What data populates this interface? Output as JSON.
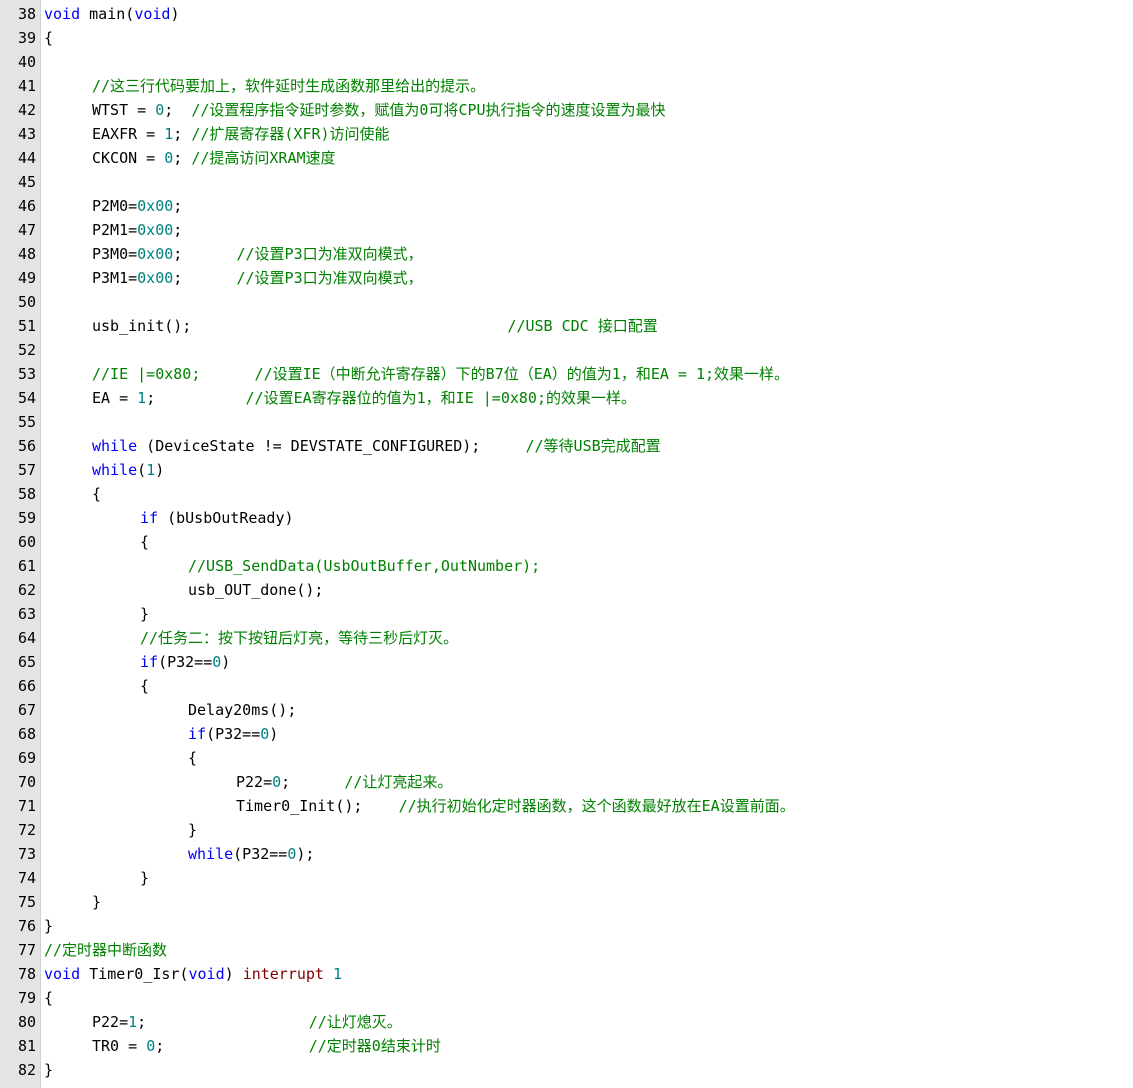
{
  "colors": {
    "keyword": "#0000ff",
    "number": "#008080",
    "comment": "#008000",
    "special": "#800000",
    "text": "#000000",
    "gutter": "#e4e4e4"
  },
  "lines": [
    {
      "n": "38",
      "indent": 0,
      "tokens": [
        {
          "t": "void",
          "c": "kw"
        },
        {
          "t": " main(",
          "c": "tx"
        },
        {
          "t": "void",
          "c": "kw"
        },
        {
          "t": ")",
          "c": "tx"
        }
      ]
    },
    {
      "n": "39",
      "indent": 0,
      "tokens": [
        {
          "t": "{",
          "c": "tx"
        }
      ]
    },
    {
      "n": "40",
      "indent": 0,
      "tokens": []
    },
    {
      "n": "41",
      "indent": 1,
      "tokens": [
        {
          "t": "//这三行代码要加上，软件延时生成函数那里给出的提示。",
          "c": "cm"
        }
      ]
    },
    {
      "n": "42",
      "indent": 1,
      "tokens": [
        {
          "t": "WTST = ",
          "c": "tx"
        },
        {
          "t": "0",
          "c": "num"
        },
        {
          "t": ";  ",
          "c": "tx"
        },
        {
          "t": "//设置程序指令延时参数，赋值为0可将CPU执行指令的速度设置为最快",
          "c": "cm"
        }
      ]
    },
    {
      "n": "43",
      "indent": 1,
      "tokens": [
        {
          "t": "EAXFR = ",
          "c": "tx"
        },
        {
          "t": "1",
          "c": "num"
        },
        {
          "t": "; ",
          "c": "tx"
        },
        {
          "t": "//扩展寄存器(XFR)访问使能",
          "c": "cm"
        }
      ]
    },
    {
      "n": "44",
      "indent": 1,
      "tokens": [
        {
          "t": "CKCON = ",
          "c": "tx"
        },
        {
          "t": "0",
          "c": "num"
        },
        {
          "t": "; ",
          "c": "tx"
        },
        {
          "t": "//提高访问XRAM速度",
          "c": "cm"
        }
      ]
    },
    {
      "n": "45",
      "indent": 0,
      "tokens": []
    },
    {
      "n": "46",
      "indent": 1,
      "tokens": [
        {
          "t": "P2M0=",
          "c": "tx"
        },
        {
          "t": "0x00",
          "c": "num"
        },
        {
          "t": ";",
          "c": "tx"
        }
      ]
    },
    {
      "n": "47",
      "indent": 1,
      "tokens": [
        {
          "t": "P2M1=",
          "c": "tx"
        },
        {
          "t": "0x00",
          "c": "num"
        },
        {
          "t": ";",
          "c": "tx"
        }
      ]
    },
    {
      "n": "48",
      "indent": 1,
      "tokens": [
        {
          "t": "P3M0=",
          "c": "tx"
        },
        {
          "t": "0x00",
          "c": "num"
        },
        {
          "t": ";      ",
          "c": "tx"
        },
        {
          "t": "//设置P3口为准双向模式，",
          "c": "cm"
        }
      ]
    },
    {
      "n": "49",
      "indent": 1,
      "tokens": [
        {
          "t": "P3M1=",
          "c": "tx"
        },
        {
          "t": "0x00",
          "c": "num"
        },
        {
          "t": ";      ",
          "c": "tx"
        },
        {
          "t": "//设置P3口为准双向模式，",
          "c": "cm"
        }
      ]
    },
    {
      "n": "50",
      "indent": 0,
      "tokens": []
    },
    {
      "n": "51",
      "indent": 1,
      "tokens": [
        {
          "t": "usb_init();                                   ",
          "c": "tx"
        },
        {
          "t": "//USB CDC 接口配置",
          "c": "cm"
        }
      ]
    },
    {
      "n": "52",
      "indent": 0,
      "tokens": []
    },
    {
      "n": "53",
      "indent": 1,
      "tokens": [
        {
          "t": "//IE |=0x80;      //设置IE（中断允许寄存器）下的B7位（EA）的值为1，和EA = 1;效果一样。",
          "c": "cm"
        }
      ]
    },
    {
      "n": "54",
      "indent": 1,
      "tokens": [
        {
          "t": "EA = ",
          "c": "tx"
        },
        {
          "t": "1",
          "c": "num"
        },
        {
          "t": ";          ",
          "c": "tx"
        },
        {
          "t": "//设置EA寄存器位的值为1，和IE |=0x80;的效果一样。",
          "c": "cm"
        }
      ]
    },
    {
      "n": "55",
      "indent": 0,
      "tokens": []
    },
    {
      "n": "56",
      "indent": 1,
      "tokens": [
        {
          "t": "while",
          "c": "kw"
        },
        {
          "t": " (DeviceState != DEVSTATE_CONFIGURED);     ",
          "c": "tx"
        },
        {
          "t": "//等待USB完成配置",
          "c": "cm"
        }
      ]
    },
    {
      "n": "57",
      "indent": 1,
      "tokens": [
        {
          "t": "while",
          "c": "kw"
        },
        {
          "t": "(",
          "c": "tx"
        },
        {
          "t": "1",
          "c": "num"
        },
        {
          "t": ")",
          "c": "tx"
        }
      ]
    },
    {
      "n": "58",
      "indent": 1,
      "tokens": [
        {
          "t": "{",
          "c": "tx"
        }
      ]
    },
    {
      "n": "59",
      "indent": 2,
      "tokens": [
        {
          "t": "if",
          "c": "kw"
        },
        {
          "t": " (bUsbOutReady)",
          "c": "tx"
        }
      ]
    },
    {
      "n": "60",
      "indent": 2,
      "tokens": [
        {
          "t": "{",
          "c": "tx"
        }
      ]
    },
    {
      "n": "61",
      "indent": 3,
      "tokens": [
        {
          "t": "//USB_SendData(UsbOutBuffer,OutNumber);",
          "c": "cm"
        }
      ]
    },
    {
      "n": "62",
      "indent": 3,
      "tokens": [
        {
          "t": "usb_OUT_done();",
          "c": "tx"
        }
      ]
    },
    {
      "n": "63",
      "indent": 2,
      "tokens": [
        {
          "t": "}",
          "c": "tx"
        }
      ]
    },
    {
      "n": "64",
      "indent": 2,
      "tokens": [
        {
          "t": "//任务二：按下按钮后灯亮，等待三秒后灯灭。",
          "c": "cm"
        }
      ]
    },
    {
      "n": "65",
      "indent": 2,
      "tokens": [
        {
          "t": "if",
          "c": "kw"
        },
        {
          "t": "(P32==",
          "c": "tx"
        },
        {
          "t": "0",
          "c": "num"
        },
        {
          "t": ")",
          "c": "tx"
        }
      ]
    },
    {
      "n": "66",
      "indent": 2,
      "tokens": [
        {
          "t": "{",
          "c": "tx"
        }
      ]
    },
    {
      "n": "67",
      "indent": 3,
      "tokens": [
        {
          "t": "Delay20ms();",
          "c": "tx"
        }
      ]
    },
    {
      "n": "68",
      "indent": 3,
      "tokens": [
        {
          "t": "if",
          "c": "kw"
        },
        {
          "t": "(P32==",
          "c": "tx"
        },
        {
          "t": "0",
          "c": "num"
        },
        {
          "t": ")",
          "c": "tx"
        }
      ]
    },
    {
      "n": "69",
      "indent": 3,
      "tokens": [
        {
          "t": "{",
          "c": "tx"
        }
      ]
    },
    {
      "n": "70",
      "indent": 4,
      "tokens": [
        {
          "t": "P22=",
          "c": "tx"
        },
        {
          "t": "0",
          "c": "num"
        },
        {
          "t": ";      ",
          "c": "tx"
        },
        {
          "t": "//让灯亮起来。",
          "c": "cm"
        }
      ]
    },
    {
      "n": "71",
      "indent": 4,
      "tokens": [
        {
          "t": "Timer0_Init();    ",
          "c": "tx"
        },
        {
          "t": "//执行初始化定时器函数，这个函数最好放在EA设置前面。",
          "c": "cm"
        }
      ]
    },
    {
      "n": "72",
      "indent": 3,
      "tokens": [
        {
          "t": "}",
          "c": "tx"
        }
      ]
    },
    {
      "n": "73",
      "indent": 3,
      "tokens": [
        {
          "t": "while",
          "c": "kw"
        },
        {
          "t": "(P32==",
          "c": "tx"
        },
        {
          "t": "0",
          "c": "num"
        },
        {
          "t": ");",
          "c": "tx"
        }
      ]
    },
    {
      "n": "74",
      "indent": 2,
      "tokens": [
        {
          "t": "}",
          "c": "tx"
        }
      ]
    },
    {
      "n": "75",
      "indent": 1,
      "tokens": [
        {
          "t": "}",
          "c": "tx"
        }
      ]
    },
    {
      "n": "76",
      "indent": 0,
      "tokens": [
        {
          "t": "}",
          "c": "tx"
        }
      ]
    },
    {
      "n": "77",
      "indent": 0,
      "tokens": [
        {
          "t": "//定时器中断函数",
          "c": "cm"
        }
      ]
    },
    {
      "n": "78",
      "indent": 0,
      "tokens": [
        {
          "t": "void",
          "c": "kw"
        },
        {
          "t": " Timer0_Isr(",
          "c": "tx"
        },
        {
          "t": "void",
          "c": "kw"
        },
        {
          "t": ") ",
          "c": "tx"
        },
        {
          "t": "interrupt",
          "c": "sp"
        },
        {
          "t": " ",
          "c": "tx"
        },
        {
          "t": "1",
          "c": "num"
        }
      ]
    },
    {
      "n": "79",
      "indent": 0,
      "tokens": [
        {
          "t": "{",
          "c": "tx"
        }
      ]
    },
    {
      "n": "80",
      "indent": 1,
      "tokens": [
        {
          "t": "P22=",
          "c": "tx"
        },
        {
          "t": "1",
          "c": "num"
        },
        {
          "t": ";                  ",
          "c": "tx"
        },
        {
          "t": "//让灯熄灭。",
          "c": "cm"
        }
      ]
    },
    {
      "n": "81",
      "indent": 1,
      "tokens": [
        {
          "t": "TR0 = ",
          "c": "tx"
        },
        {
          "t": "0",
          "c": "num"
        },
        {
          "t": ";                ",
          "c": "tx"
        },
        {
          "t": "//定时器0结束计时",
          "c": "cm"
        }
      ]
    },
    {
      "n": "82",
      "indent": 0,
      "tokens": [
        {
          "t": "}",
          "c": "tx"
        }
      ]
    }
  ]
}
